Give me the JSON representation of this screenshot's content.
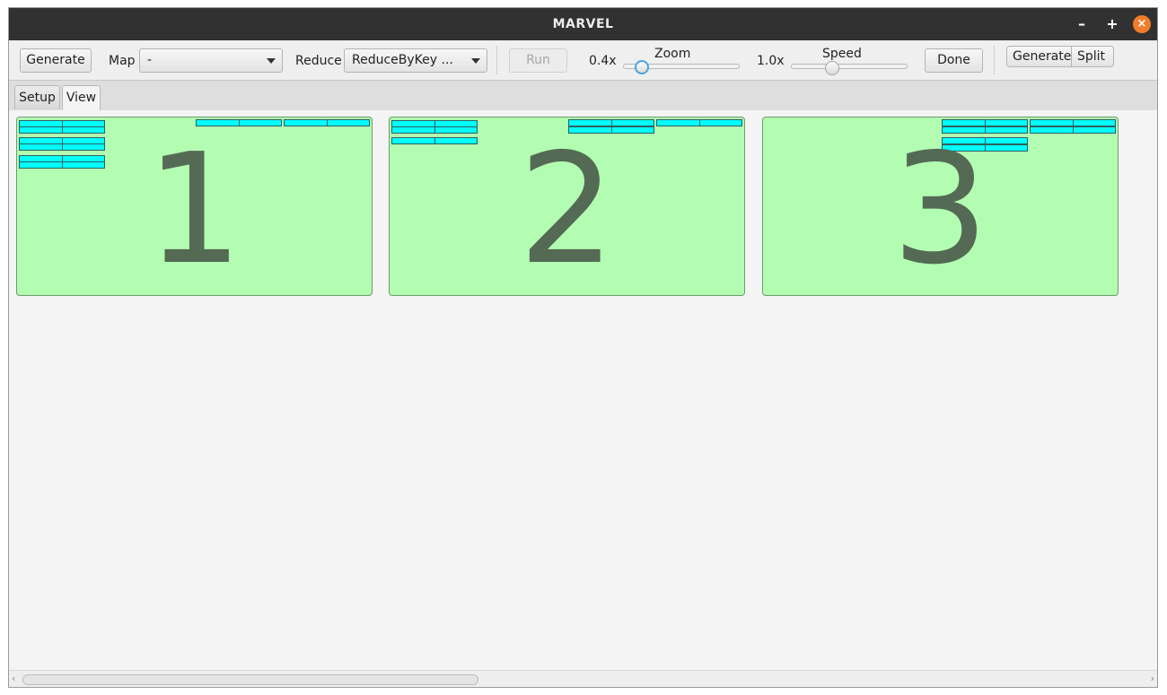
{
  "window": {
    "title": "MARVEL",
    "minimize": "–",
    "maximize": "+",
    "close": "×"
  },
  "toolbar": {
    "generate_label": "Generate",
    "map_label": "Map",
    "map_value": "-",
    "reduce_label": "Reduce",
    "reduce_value": "ReduceByKey ...",
    "run_label": "Run",
    "zoom_min": "0.4x",
    "zoom_label": "Zoom",
    "zoom_level": 0.1,
    "speed_min": "1.0x",
    "speed_label": "Speed",
    "speed_level": 0.3,
    "done_label": "Done",
    "breadcrumbs": [
      "Generate",
      "Split"
    ]
  },
  "tabs": [
    {
      "label": "Setup",
      "active": false
    },
    {
      "label": "View",
      "active": true
    }
  ],
  "splits": [
    {
      "number": "1"
    },
    {
      "number": "2"
    },
    {
      "number": "3"
    }
  ],
  "colors": {
    "split_bg": "#b3fdb3",
    "cell_bg": "#00ffff",
    "accent": "#4aa3df"
  }
}
